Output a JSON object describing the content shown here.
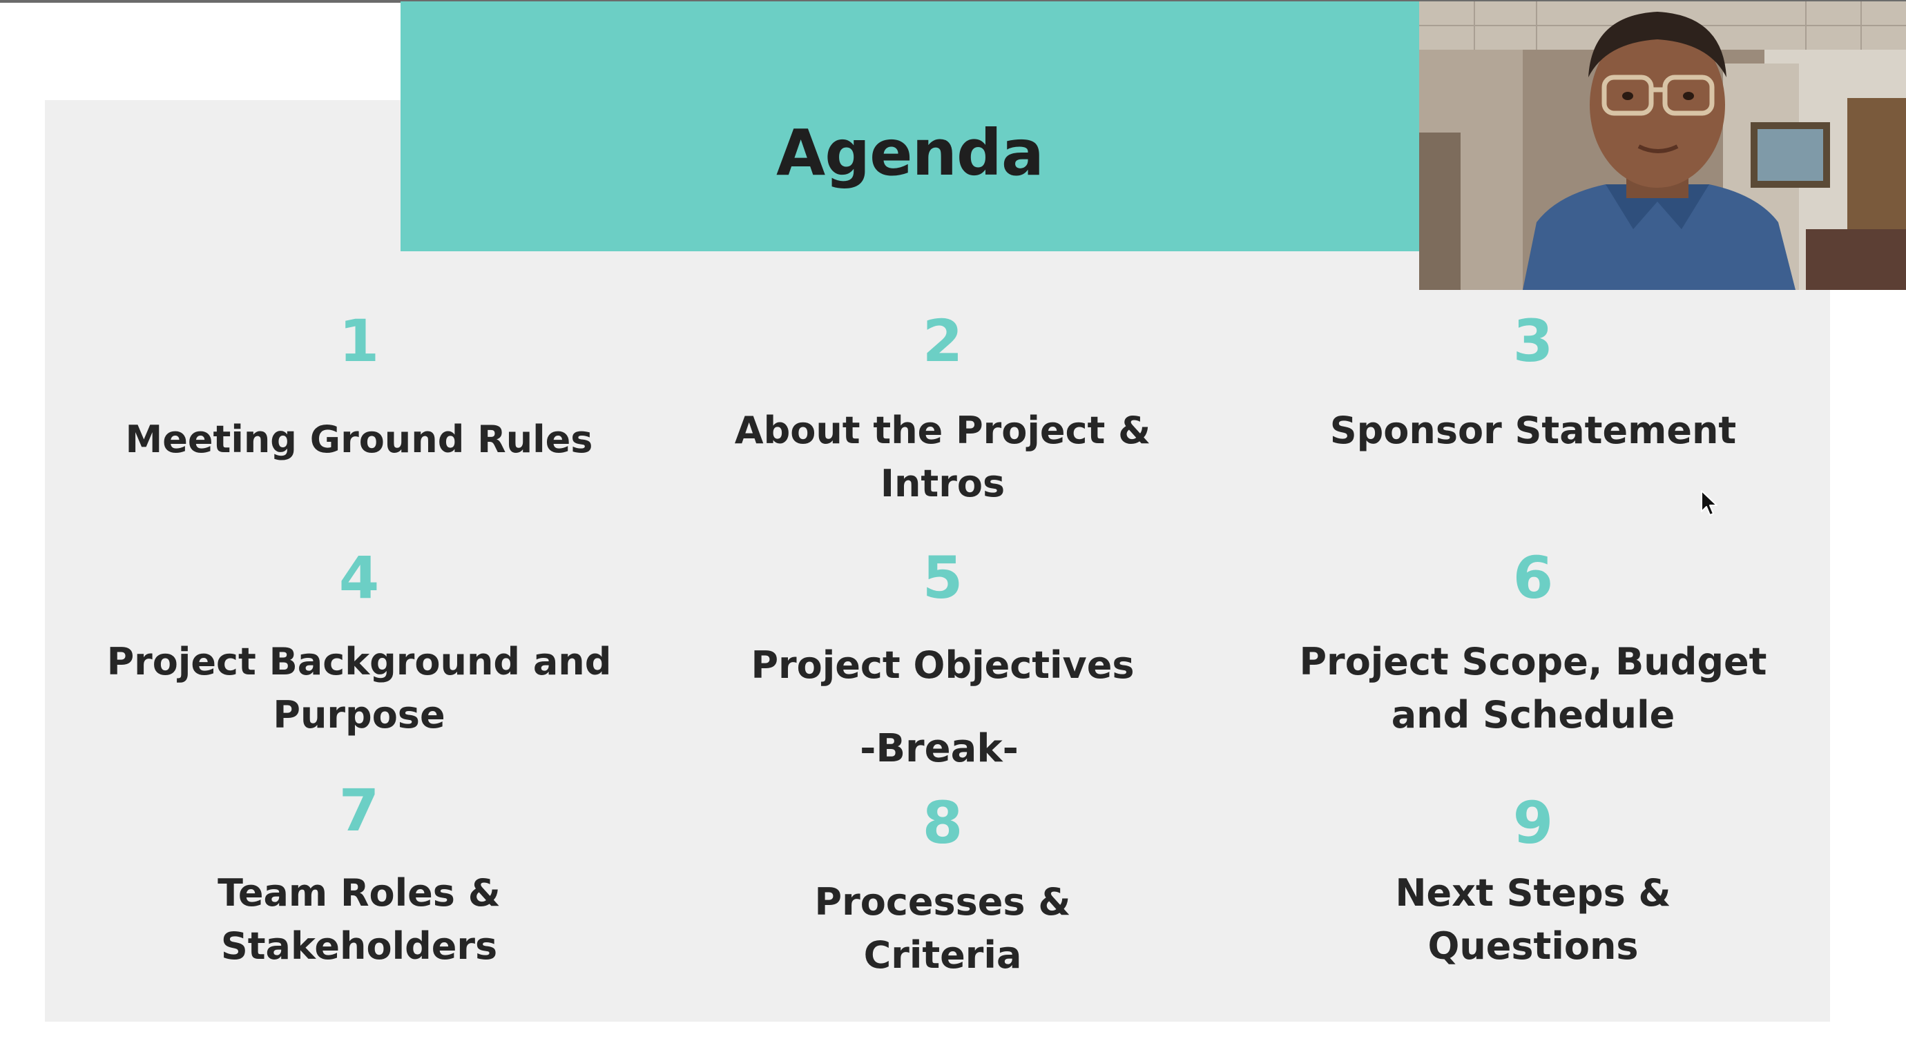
{
  "slide": {
    "title": "Agenda",
    "break_label": "-Break-",
    "items": [
      {
        "number": "1",
        "label": "Meeting Ground Rules"
      },
      {
        "number": "2",
        "label": "About the Project & Intros"
      },
      {
        "number": "3",
        "label": "Sponsor Statement"
      },
      {
        "number": "4",
        "label": "Project Background and Purpose"
      },
      {
        "number": "5",
        "label": "Project Objectives"
      },
      {
        "number": "6",
        "label": "Project Scope, Budget and Schedule"
      },
      {
        "number": "7",
        "label": "Team Roles & Stakeholders"
      },
      {
        "number": "8",
        "label": "Processes & Criteria"
      },
      {
        "number": "9",
        "label": "Next Steps & Questions"
      }
    ]
  },
  "colors": {
    "accent": "#6ccfc5",
    "slide_background": "#efefef",
    "text": "#262626"
  },
  "icons": {
    "cursor": "mouse-pointer-icon",
    "webcam": "presenter-video-feed"
  }
}
